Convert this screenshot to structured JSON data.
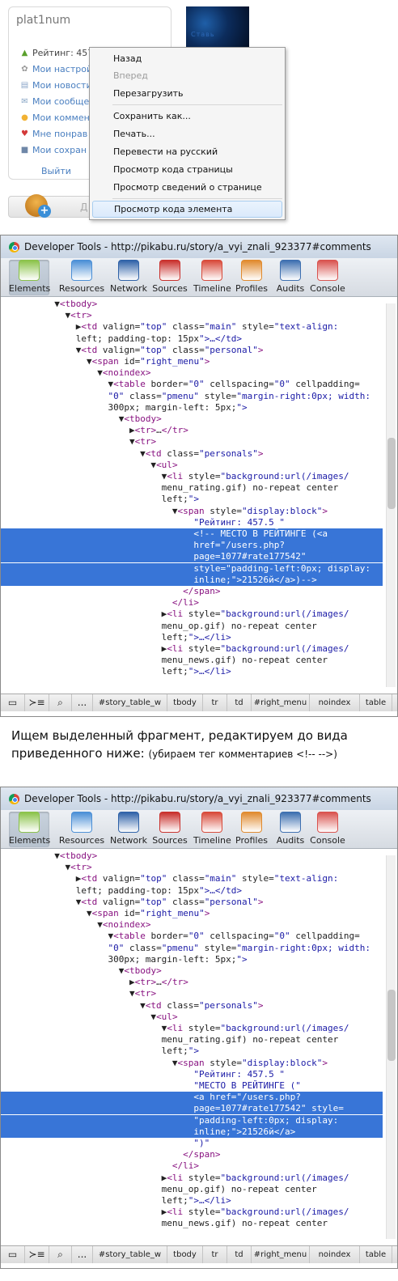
{
  "profile": {
    "username": "plat1num",
    "menu": [
      {
        "icon": "rating-icon",
        "glyph": "▲",
        "color": "#5aa02c",
        "label": "Рейтинг: 457.5"
      },
      {
        "icon": "settings-icon",
        "glyph": "✿",
        "color": "#9a9a9a",
        "label": "Мои настрой"
      },
      {
        "icon": "news-icon",
        "glyph": "▤",
        "color": "#8ba7c9",
        "label": "Мои новости"
      },
      {
        "icon": "messages-icon",
        "glyph": "✉",
        "color": "#88a6c6",
        "label": "Мои сообще"
      },
      {
        "icon": "comments-icon",
        "glyph": "●",
        "color": "#f2b233",
        "label": "Мои коммен"
      },
      {
        "icon": "heart-icon",
        "glyph": "♥",
        "color": "#d33a3a",
        "label": "Мне понрав"
      },
      {
        "icon": "save-icon",
        "glyph": "■",
        "color": "#6f87a8",
        "label": "Мои сохран"
      }
    ],
    "logout": "Выйти",
    "avatar_text": "Ставь",
    "add_label": "Д"
  },
  "context_menu": {
    "back": "Назад",
    "forward": "Вперед",
    "reload": "Перезагрузить",
    "save_as": "Сохранить как...",
    "print": "Печать...",
    "translate": "Перевести на русский",
    "view_source": "Просмотр кода страницы",
    "page_info": "Просмотр  сведений о странице",
    "inspect": "Просмотр кода элемента"
  },
  "devtools": {
    "title": "Developer Tools - http://pikabu.ru/story/a_vyi_znali_923377#comments",
    "tools": [
      {
        "label": "Elements",
        "icon": "elements-icon",
        "color": "#8bc34a"
      },
      {
        "label": "Resources",
        "icon": "resources-icon",
        "color": "#4b8fd6"
      },
      {
        "label": "Network",
        "icon": "network-icon",
        "color": "#2f62a8"
      },
      {
        "label": "Sources",
        "icon": "sources-icon",
        "color": "#c9302c"
      },
      {
        "label": "Timeline",
        "icon": "timeline-icon",
        "color": "#d84a3a"
      },
      {
        "label": "Profiles",
        "icon": "profiles-icon",
        "color": "#e08a2e"
      },
      {
        "label": "Audits",
        "icon": "audits-icon",
        "color": "#3d6fb0"
      },
      {
        "label": "Console",
        "icon": "console-icon",
        "color": "#d9534f"
      }
    ],
    "breadcrumbs": [
      "#story_table_w",
      "tbody",
      "tr",
      "td",
      "#right_menu",
      "noindex",
      "table"
    ],
    "ellipsis": "..."
  },
  "panel1": {
    "lines": [
      {
        "text": "          ▼<tbody>"
      },
      {
        "text": "            ▼<tr>"
      },
      {
        "text": "              ▶<td valign=\"top\" class=\"main\" style=\"text-align:"
      },
      {
        "text": "              left; padding-top: 15px\">…</td>"
      },
      {
        "text": "              ▼<td valign=\"top\" class=\"personal\">"
      },
      {
        "text": "                ▼<span id=\"right_menu\">"
      },
      {
        "text": "                  ▼<noindex>"
      },
      {
        "text": "                    ▼<table border=\"0\" cellspacing=\"0\" cellpadding="
      },
      {
        "text": "                    \"0\" class=\"pmenu\" style=\"margin-right:0px; width:"
      },
      {
        "text": "                    300px; margin-left: 5px;\">"
      },
      {
        "text": "                      ▼<tbody>"
      },
      {
        "text": "                        ▶<tr>…</tr>"
      },
      {
        "text": "                        ▼<tr>"
      },
      {
        "text": "                          ▼<td class=\"personals\">"
      },
      {
        "text": "                            ▼<ul>"
      },
      {
        "text": "                              ▼<li style=\"background:url(/images/"
      },
      {
        "text": "                              menu_rating.gif) no-repeat center"
      },
      {
        "text": "                              left;\">"
      },
      {
        "text": "                                ▼<span style=\"display:block\">"
      },
      {
        "text": "                                    \"Рейтинг: 457.5 \""
      },
      {
        "text": "                                    <!-- МЕСТО В РЕЙТИНГЕ (<a",
        "hl": true
      },
      {
        "text": "                                    href=\"/users.php?",
        "hl": true
      },
      {
        "text": "                                    page=1077#rate177542\"",
        "hl": true
      },
      {
        "text": "                                    style=\"padding-left:0px; display:",
        "hl": true
      },
      {
        "text": "                                    inline;\">21526й</a>)-->",
        "hl": true
      },
      {
        "text": "                                  </span>"
      },
      {
        "text": "                                </li>"
      },
      {
        "text": "                              ▶<li style=\"background:url(/images/"
      },
      {
        "text": "                              menu_op.gif) no-repeat center"
      },
      {
        "text": "                              left;\">…</li>"
      },
      {
        "text": "                              ▶<li style=\"background:url(/images/"
      },
      {
        "text": "                              menu_news.gif) no-repeat center"
      },
      {
        "text": "                              left;\">…</li>"
      }
    ]
  },
  "instruction": {
    "main": "Ищем выделенный фрагмент, редактируем до вида приведенного ниже:",
    "note": "(убираем тег комментариев <!-- -->)"
  },
  "panel2": {
    "lines": [
      {
        "text": "          ▼<tbody>"
      },
      {
        "text": "            ▼<tr>"
      },
      {
        "text": "              ▶<td valign=\"top\" class=\"main\" style=\"text-align:"
      },
      {
        "text": "              left; padding-top: 15px\">…</td>"
      },
      {
        "text": "              ▼<td valign=\"top\" class=\"personal\">"
      },
      {
        "text": "                ▼<span id=\"right_menu\">"
      },
      {
        "text": "                  ▼<noindex>"
      },
      {
        "text": "                    ▼<table border=\"0\" cellspacing=\"0\" cellpadding="
      },
      {
        "text": "                    \"0\" class=\"pmenu\" style=\"margin-right:0px; width:"
      },
      {
        "text": "                    300px; margin-left: 5px;\">"
      },
      {
        "text": "                      ▼<tbody>"
      },
      {
        "text": "                        ▶<tr>…</tr>"
      },
      {
        "text": "                        ▼<tr>"
      },
      {
        "text": "                          ▼<td class=\"personals\">"
      },
      {
        "text": "                            ▼<ul>"
      },
      {
        "text": "                              ▼<li style=\"background:url(/images/"
      },
      {
        "text": "                              menu_rating.gif) no-repeat center"
      },
      {
        "text": "                              left;\">"
      },
      {
        "text": "                                ▼<span style=\"display:block\">"
      },
      {
        "text": "                                    \"Рейтинг: 457.5 \""
      },
      {
        "text": "                                    \"МЕСТО В РЕЙТИНГЕ (\""
      },
      {
        "text": "                                    <a href=\"/users.php?",
        "hl": true
      },
      {
        "text": "                                    page=1077#rate177542\" style=",
        "hl": true
      },
      {
        "text": "                                    \"padding-left:0px; display:",
        "hl": true
      },
      {
        "text": "                                    inline;\">21526й</a>",
        "hl": true
      },
      {
        "text": "                                    \")\""
      },
      {
        "text": "                                  </span>"
      },
      {
        "text": "                                </li>"
      },
      {
        "text": "                              ▶<li style=\"background:url(/images/"
      },
      {
        "text": "                              menu_op.gif) no-repeat center"
      },
      {
        "text": "                              left;\">…</li>"
      },
      {
        "text": "                              ▶<li style=\"background:url(/images/"
      },
      {
        "text": "                              menu_news.gif) no-repeat center"
      }
    ]
  }
}
